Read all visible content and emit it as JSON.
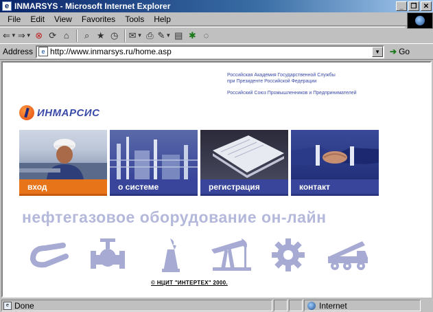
{
  "window": {
    "title": "INMARSYS - Microsoft Internet Explorer",
    "app_icon": "ie-icon"
  },
  "menu": [
    {
      "label": "File"
    },
    {
      "label": "Edit"
    },
    {
      "label": "View"
    },
    {
      "label": "Favorites"
    },
    {
      "label": "Tools"
    },
    {
      "label": "Help"
    }
  ],
  "toolbar": {
    "icons": [
      "back-icon",
      "forward-icon",
      "stop-icon",
      "refresh-icon",
      "home-icon",
      "search-icon",
      "favorites-icon",
      "history-icon",
      "mail-icon",
      "print-icon",
      "edit-icon",
      "discuss-icon",
      "messenger-icon"
    ]
  },
  "address": {
    "label": "Address",
    "url": "http://www.inmarsys.ru/home.asp",
    "go_label": "Go"
  },
  "page": {
    "org_line1": "Российская Академия Государственной Службы",
    "org_line2": "при Президенте Российской Федерации",
    "org_line3": "Российский Союз Промышленников и Предпринимателей",
    "logo_text": "ИНМАРСИС",
    "tiles": [
      {
        "label": "вход",
        "photo": "worker-photo"
      },
      {
        "label": "о системе",
        "photo": "refinery-photo"
      },
      {
        "label": "регистрация",
        "photo": "papers-photo"
      },
      {
        "label": "контакт",
        "photo": "handshake-photo"
      }
    ],
    "slogan": "нефтегазовое оборудование он-лайн",
    "equipment_icons": [
      "pipe-bend-icon",
      "valve-icon",
      "flare-stack-icon",
      "pumpjack-icon",
      "gear-icon",
      "crane-truck-icon"
    ],
    "copyright": "© НЦИТ \"ИНТЕРТЕХ\" 2000."
  },
  "status": {
    "text": "Done",
    "zone": "Internet"
  },
  "colors": {
    "orange": "#e8741a",
    "blue": "#38459a",
    "slogan": "#b4b8da",
    "icons": "#a7abd3"
  }
}
